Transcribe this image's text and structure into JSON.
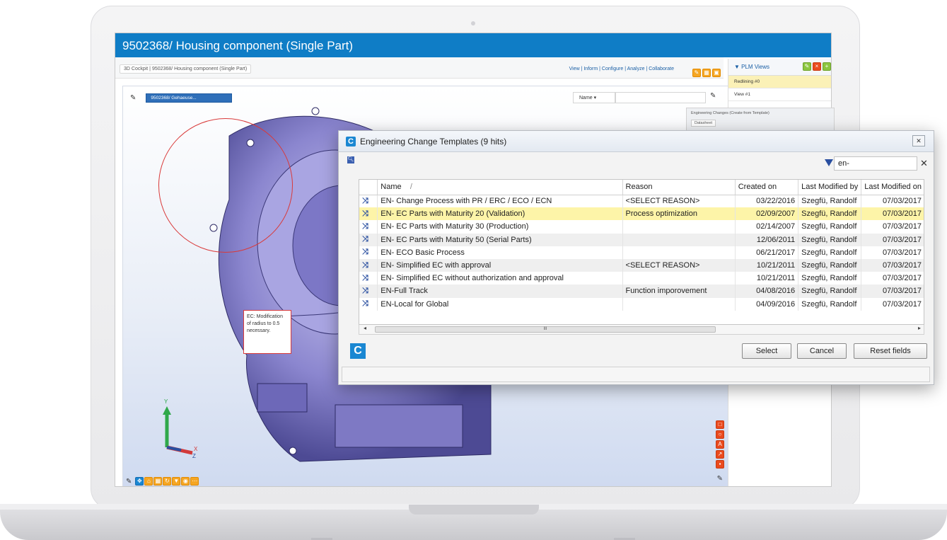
{
  "app": {
    "window_title": "9502368/ Housing component (Single Part)",
    "breadcrumb": "3D Cockpit  |  9502368/ Housing component (Single Part)",
    "top_links": "View | Inform | Configure | Analyze | Collaborate",
    "tree_node": "9502368/ Gehaeuse...",
    "name_select": "Name",
    "ec_note": "EC: Modification of radius to 0.5 necessary."
  },
  "plm": {
    "title": "PLM Views",
    "rows": [
      "Redlining #0",
      "View #1"
    ],
    "eng_panel_title": "Engineering Changes (Create from Template)",
    "eng_panel_tab": "Datasheet"
  },
  "dialog": {
    "title": "Engineering Change Templates (9 hits)",
    "filter_value": "en-",
    "columns": [
      "Name",
      "Reason",
      "Created on",
      "Last Modified by",
      "Last Modified on"
    ],
    "sort_marker": "/",
    "rows": [
      {
        "name": "EN- Change Process with PR / ERC / ECO / ECN",
        "reason": "<SELECT REASON>",
        "created": "03/22/2016",
        "modified_by": "Szegfü, Randolf",
        "modified_on": "07/03/2017"
      },
      {
        "name": "EN- EC Parts with Maturity 20 (Validation)",
        "reason": "Process optimization",
        "created": "02/09/2007",
        "modified_by": "Szegfü, Randolf",
        "modified_on": "07/03/2017"
      },
      {
        "name": "EN- EC Parts with Maturity 30 (Production)",
        "reason": "",
        "created": "02/14/2007",
        "modified_by": "Szegfü, Randolf",
        "modified_on": "07/03/2017"
      },
      {
        "name": "EN- EC Parts with Maturity 50 (Serial Parts)",
        "reason": "",
        "created": "12/06/2011",
        "modified_by": "Szegfü, Randolf",
        "modified_on": "07/03/2017"
      },
      {
        "name": "EN- ECO Basic Process",
        "reason": "",
        "created": "06/21/2017",
        "modified_by": "Szegfü, Randolf",
        "modified_on": "07/03/2017"
      },
      {
        "name": "EN- Simplified EC with approval",
        "reason": "<SELECT REASON>",
        "created": "10/21/2011",
        "modified_by": "Szegfü, Randolf",
        "modified_on": "07/03/2017"
      },
      {
        "name": "EN- Simplified EC without authorization and approval",
        "reason": "",
        "created": "10/21/2011",
        "modified_by": "Szegfü, Randolf",
        "modified_on": "07/03/2017"
      },
      {
        "name": "EN-Full Track",
        "reason": "Function imporovement",
        "created": "04/08/2016",
        "modified_by": "Szegfü, Randolf",
        "modified_on": "07/03/2017"
      },
      {
        "name": "EN-Local for Global",
        "reason": "",
        "created": "04/09/2016",
        "modified_by": "Szegfü, Randolf",
        "modified_on": "07/03/2017"
      }
    ],
    "selected_row": 1,
    "scroll_thumb": "III",
    "buttons": {
      "select": "Select",
      "cancel": "Cancel",
      "reset": "Reset fields"
    }
  },
  "icons": {
    "row_icon": "change-process-icon",
    "filter_icon": "funnel-icon",
    "logo": "C"
  },
  "colors": {
    "titlebar": "#0f7dc6",
    "selection": "#fdf4a8",
    "annotation": "#d93a3a"
  }
}
